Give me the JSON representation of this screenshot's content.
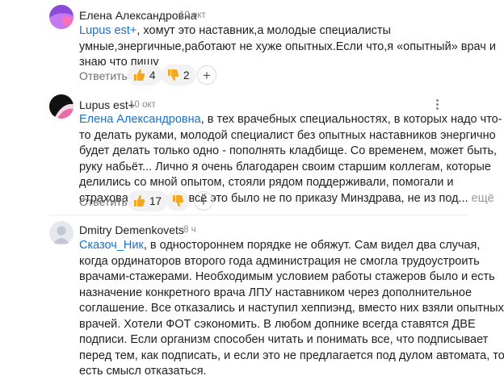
{
  "comments": [
    {
      "author": "Елена Александровна",
      "time": "10 окт",
      "lines": [
        {
          "mention": "Lupus est+",
          "text": ", хомут это наставник,а молодые специалисты"
        },
        {
          "text": "умные,энергичные,работают не хуже опытных.Если что,я «опытный» врач и"
        },
        {
          "text": "знаю что пишу"
        }
      ],
      "reply_label": "Ответить",
      "likes": "4",
      "dislikes": "2",
      "add_reaction": "+"
    },
    {
      "author": "Lupus est+",
      "time": "10 окт",
      "lines": [
        {
          "mention": "Елена Александровна",
          "text": ", в тех врачебных специальностях, в которых надо что-"
        },
        {
          "text": "то делать руками, молодой специалист без опытных наставников энергично"
        },
        {
          "text": "будет делать только одно - пополнять кладбище. Со временем, может быть,"
        },
        {
          "text": "руку набьёт... Лично я очень благодарен своим старшим коллегам, которые"
        },
        {
          "text": "делились со мной опытом, стояли рядом поддерживали, помогали и"
        },
        {
          "text": "страховали. Только всё это было не по приказу Минздрава, не из под..."
        }
      ],
      "more_label": "ещё",
      "reply_label": "Ответить",
      "likes": "17",
      "add_reaction": "+"
    },
    {
      "author": "Dmitry Demenkovets",
      "time": "8 ч",
      "lines": [
        {
          "mention": "Сказоч_Ник",
          "text": ", в одностороннем порядке не обяжут. Сам видел два случая,"
        },
        {
          "text": "когда ординаторов второго года администрация не смогла трудоустроить"
        },
        {
          "text": "врачами-стажерами. Необходимым условием работы стажеров было и есть"
        },
        {
          "text": "назначение конкретного врача ЛПУ наставником через дополнительное"
        },
        {
          "text": "соглашение. Все отказались и наступил хеппиэнд, вместо них взяли опытных"
        },
        {
          "text": "врачей. Хотели ФОТ сэкономить. В любом допнике всегда ставятся ДВЕ"
        },
        {
          "text": "подписи. Если организм способен читать и понимать все, что подписывает"
        },
        {
          "text": "перед тем, как подписать, и если это не предлагается под дулом автомата, то"
        },
        {
          "text": "есть смысл отказаться."
        }
      ]
    }
  ],
  "colors": {
    "mention": "#1a6fd1",
    "like_icon": "#f5a623",
    "dislike_icon": "#f5a623",
    "avatar1": "#8a4bd8",
    "avatar2": "#111111",
    "avatar3": "#c9ccd6"
  }
}
